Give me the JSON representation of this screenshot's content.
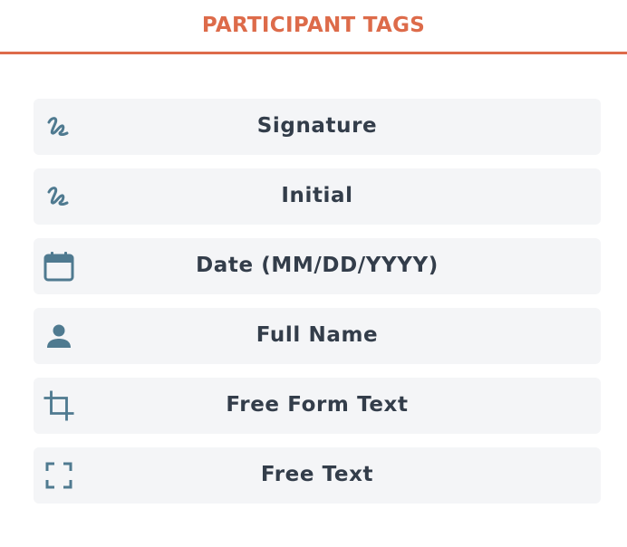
{
  "header": {
    "title": "PARTICIPANT TAGS"
  },
  "colors": {
    "accent": "#dd6b4a",
    "icon": "#4f7a90",
    "item_background": "#f4f5f7",
    "label": "#333d4a"
  },
  "tags": [
    {
      "label": "Signature",
      "icon": "signature-icon"
    },
    {
      "label": "Initial",
      "icon": "signature-icon"
    },
    {
      "label": "Date (MM/DD/YYYY)",
      "icon": "calendar-icon"
    },
    {
      "label": "Full Name",
      "icon": "person-icon"
    },
    {
      "label": "Free Form Text",
      "icon": "crop-icon"
    },
    {
      "label": "Free Text",
      "icon": "fullscreen-frame-icon"
    }
  ]
}
